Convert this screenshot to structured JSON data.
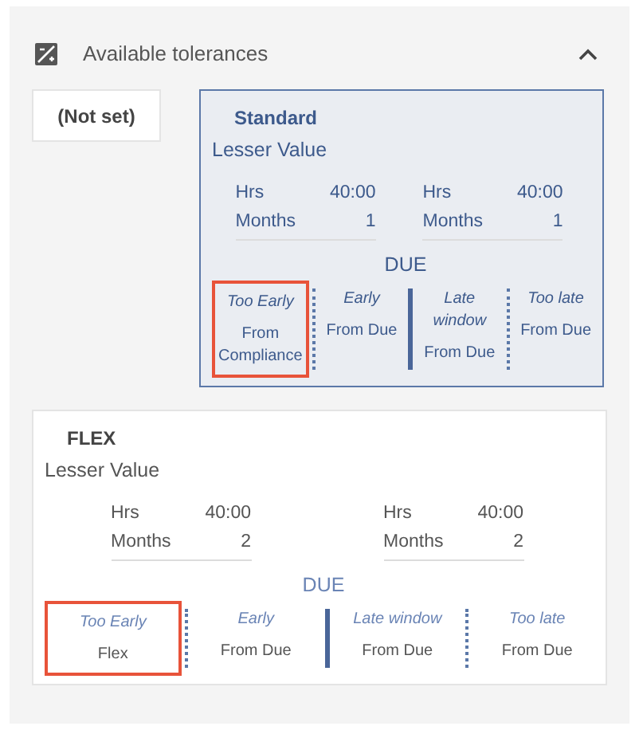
{
  "section": {
    "title": "Available tolerances",
    "expanded": true
  },
  "tolerances": [
    {
      "kind": "empty",
      "name": "(Not set)",
      "selected": false
    },
    {
      "kind": "detail",
      "name": "Standard",
      "selected": true,
      "basis": "Lesser Value",
      "limits": [
        [
          {
            "label": "Hrs",
            "value": "40:00"
          },
          {
            "label": "Months",
            "value": "1"
          }
        ],
        [
          {
            "label": "Hrs",
            "value": "40:00"
          },
          {
            "label": "Months",
            "value": "1"
          }
        ]
      ],
      "due": "DUE",
      "windows": [
        {
          "title": "Too Early",
          "basis": "From Compliance",
          "highlighted": true
        },
        {
          "title": "Early",
          "basis": "From Due",
          "highlighted": false
        },
        {
          "title": "Late window",
          "basis": "From Due",
          "highlighted": false
        },
        {
          "title": "Too late",
          "basis": "From Due",
          "highlighted": false
        }
      ]
    },
    {
      "kind": "detail",
      "name": "FLEX",
      "selected": false,
      "basis": "Lesser Value",
      "limits": [
        [
          {
            "label": "Hrs",
            "value": "40:00"
          },
          {
            "label": "Months",
            "value": "2"
          }
        ],
        [
          {
            "label": "Hrs",
            "value": "40:00"
          },
          {
            "label": "Months",
            "value": "2"
          }
        ]
      ],
      "due": "DUE",
      "windows": [
        {
          "title": "Too Early",
          "basis": "Flex",
          "highlighted": true
        },
        {
          "title": "Early",
          "basis": "From Due",
          "highlighted": false
        },
        {
          "title": "Late window",
          "basis": "From Due",
          "highlighted": false
        },
        {
          "title": "Too late",
          "basis": "From Due",
          "highlighted": false
        }
      ]
    }
  ]
}
